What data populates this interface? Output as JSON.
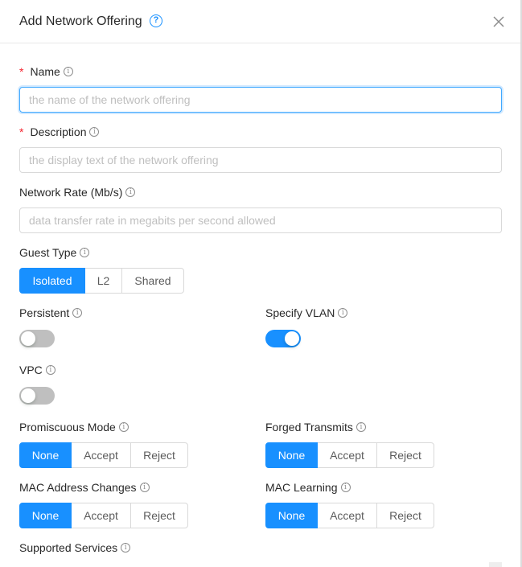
{
  "dialog": {
    "title": "Add Network Offering",
    "help_icon": "question-circle-icon",
    "close_icon": "close-icon"
  },
  "form": {
    "name": {
      "label": "Name",
      "required": "*",
      "placeholder": "the name of the network offering",
      "value": ""
    },
    "description": {
      "label": "Description",
      "required": "*",
      "placeholder": "the display text of the network offering",
      "value": ""
    },
    "network_rate": {
      "label": "Network Rate (Mb/s)",
      "placeholder": "data transfer rate in megabits per second allowed",
      "value": ""
    },
    "guest_type": {
      "label": "Guest Type",
      "options": [
        "Isolated",
        "L2",
        "Shared"
      ],
      "selected": "Isolated"
    },
    "persistent": {
      "label": "Persistent",
      "checked": false
    },
    "specify_vlan": {
      "label": "Specify VLAN",
      "checked": true
    },
    "vpc": {
      "label": "VPC",
      "checked": false
    },
    "promiscuous_mode": {
      "label": "Promiscuous Mode",
      "options": [
        "None",
        "Accept",
        "Reject"
      ],
      "selected": "None"
    },
    "forged_transmits": {
      "label": "Forged Transmits",
      "options": [
        "None",
        "Accept",
        "Reject"
      ],
      "selected": "None"
    },
    "mac_address_changes": {
      "label": "MAC Address Changes",
      "options": [
        "None",
        "Accept",
        "Reject"
      ],
      "selected": "None"
    },
    "mac_learning": {
      "label": "MAC Learning",
      "options": [
        "None",
        "Accept",
        "Reject"
      ],
      "selected": "None"
    },
    "supported_services": {
      "label": "Supported Services"
    }
  },
  "colors": {
    "primary": "#1890ff",
    "required": "#f5222d",
    "switch_off": "#bfbfbf"
  }
}
